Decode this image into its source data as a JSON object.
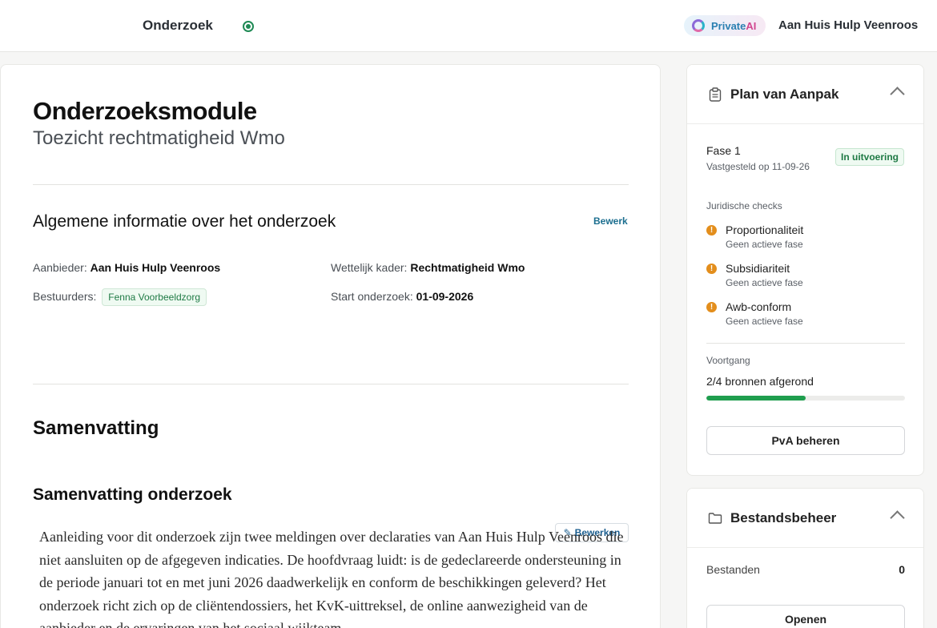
{
  "header": {
    "title": "Onderzoek",
    "brand_prefix": "Private",
    "brand_suffix": "AI",
    "user": "Aan Huis Hulp Veenroos"
  },
  "main": {
    "title": "Onderzoeksmodule",
    "subtitle": "Toezicht rechtmatigheid Wmo",
    "general": {
      "heading": "Algemene informatie over het onderzoek",
      "edit_label": "Bewerk",
      "provider_label": "Aanbieder:",
      "provider_value": "Aan Huis Hulp Veenroos",
      "legal_label": "Wettelijk kader:",
      "legal_value": "Rechtmatigheid Wmo",
      "directors_label": "Bestuurders:",
      "directors_value": "Fenna Voorbeeldzorg",
      "start_label": "Start onderzoek:",
      "start_value": "01-09-2026"
    },
    "summary": {
      "heading": "Samenvatting",
      "subheading": "Samenvatting onderzoek",
      "edit_label": "Bewerken",
      "text": "Aanleiding voor dit onderzoek zijn twee meldingen over declaraties van Aan Huis Hulp Veenroos die niet aansluiten op de afgegeven indicaties. De hoofdvraag luidt: is de gedeclareerde ondersteuning in de periode januari tot en met juni 2026 daadwerkelijk en conform de beschikkingen geleverd? Het onderzoek richt zich op de cliëntendossiers, het KvK-uittreksel, de online aanwezigheid van de aanbieder en de ervaringen van het sociaal wijkteam."
    }
  },
  "plan": {
    "title": "Plan van Aanpak",
    "phase": "Fase 1",
    "phase_sub": "Vastgesteld op 11-09-26",
    "phase_status": "In uitvoering",
    "checks_label": "Juridische checks",
    "checks": [
      {
        "name": "Proportionaliteit",
        "status": "Geen actieve fase"
      },
      {
        "name": "Subsidiariteit",
        "status": "Geen actieve fase"
      },
      {
        "name": "Awb-conform",
        "status": "Geen actieve fase"
      }
    ],
    "progress_label": "Voortgang",
    "progress_text": "2/4 bronnen afgerond",
    "progress_fraction": 0.5,
    "button": "PvA beheren"
  },
  "files": {
    "title": "Bestandsbeheer",
    "label": "Bestanden",
    "count": "0",
    "button": "Openen"
  },
  "colors": {
    "accent_green": "#1f9e4e",
    "warning": "#e38e1c",
    "link": "#1b6e8f"
  }
}
